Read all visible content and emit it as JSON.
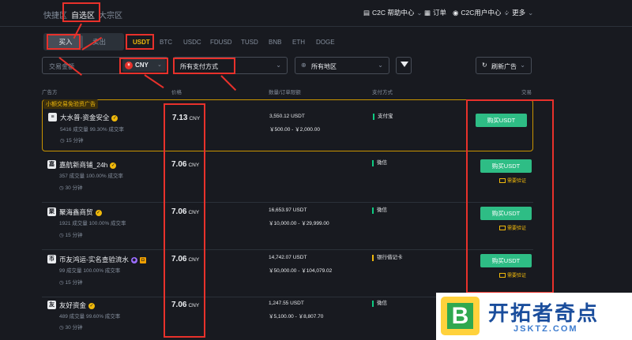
{
  "nav": {
    "tabs": [
      "快捷区",
      "自选区",
      "大宗区"
    ],
    "right": [
      "C2C 帮助中心",
      "订单",
      "C2C用户中心",
      "更多"
    ]
  },
  "trade": {
    "buy": "买入",
    "sell": "卖出",
    "coins": [
      "USDT",
      "BTC",
      "USDC",
      "FDUSD",
      "TUSD",
      "BNB",
      "ETH",
      "DOGE"
    ]
  },
  "filters": {
    "amount_placeholder": "交易金额",
    "currency": "CNY",
    "payment": "所有支付方式",
    "region": "所有地区",
    "refresh": "刷新广告"
  },
  "table": {
    "headers": [
      "广告方",
      "价格",
      "数量/订单限额",
      "支付方式",
      "交易"
    ],
    "promo_label": "小额交易免验资广告",
    "rows": [
      {
        "name": "大水普-资金安全",
        "avatar": "≡",
        "stats": "5416 成交量  99.30% 成交率",
        "time": "15 分钟",
        "price": "7.13",
        "currency": "CNY",
        "amount": "3,550.12 USDT",
        "limit": "￥500.00 - ￥2,000.00",
        "payment": "支付宝",
        "button": "购买USDT",
        "verify": ""
      },
      {
        "name": "嘉航新商铺_24h",
        "avatar": "嘉",
        "stats": "357 成交量  100.00% 成交率",
        "time": "30 分钟",
        "price": "7.06",
        "currency": "CNY",
        "amount": "",
        "limit": "",
        "payment": "微信",
        "button": "购买USDT",
        "verify": "需要验证"
      },
      {
        "name": "聚海鑫商贸",
        "avatar": "聚",
        "stats": "1921 成交量  100.00% 成交率",
        "time": "15 分钟",
        "price": "7.06",
        "currency": "CNY",
        "amount": "16,653.97 USDT",
        "limit": "￥10,000.00 - ￥29,999.00",
        "payment": "微信",
        "button": "购买USDT",
        "verify": "需要验证"
      },
      {
        "name": "币友鸿运-实名查验流水",
        "avatar": "币",
        "stats": "99 成交量  100.00% 成交率",
        "time": "15 分钟",
        "price": "7.06",
        "currency": "CNY",
        "amount": "14,742.07 USDT",
        "limit": "￥50,000.00 - ￥104,079.02",
        "payment": "银行借记卡",
        "button": "购买USDT",
        "verify": "需要验证"
      },
      {
        "name": "友好资金",
        "avatar": "友",
        "stats": "489 成交量  99.60% 成交率",
        "time": "30 分钟",
        "price": "7.06",
        "currency": "CNY",
        "amount": "1,247.55 USDT",
        "limit": "￥5,100.00 - ￥8,807.70",
        "payment": "微信",
        "button": "",
        "verify": ""
      }
    ]
  },
  "watermark": {
    "letter": "B",
    "cn": "开拓者奇点",
    "en": "JSKTZ.COM"
  }
}
